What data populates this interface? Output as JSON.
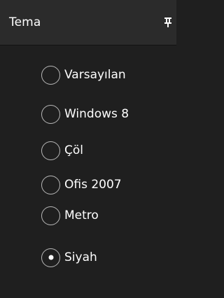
{
  "panel": {
    "title": "Tema",
    "pin_icon": "pin-icon"
  },
  "theme_options": [
    {
      "label": "Varsayılan",
      "selected": false
    },
    {
      "label": "Windows 8",
      "selected": false
    },
    {
      "label": "Çöl",
      "selected": false
    },
    {
      "label": "Ofis 2007",
      "selected": false
    },
    {
      "label": "Metro",
      "selected": false
    },
    {
      "label": "Siyah",
      "selected": true
    }
  ],
  "colors": {
    "background": "#1f1f1f",
    "header_background": "#2b2b2b",
    "text": "#ffffff",
    "radio_border": "#b8b8b8"
  }
}
